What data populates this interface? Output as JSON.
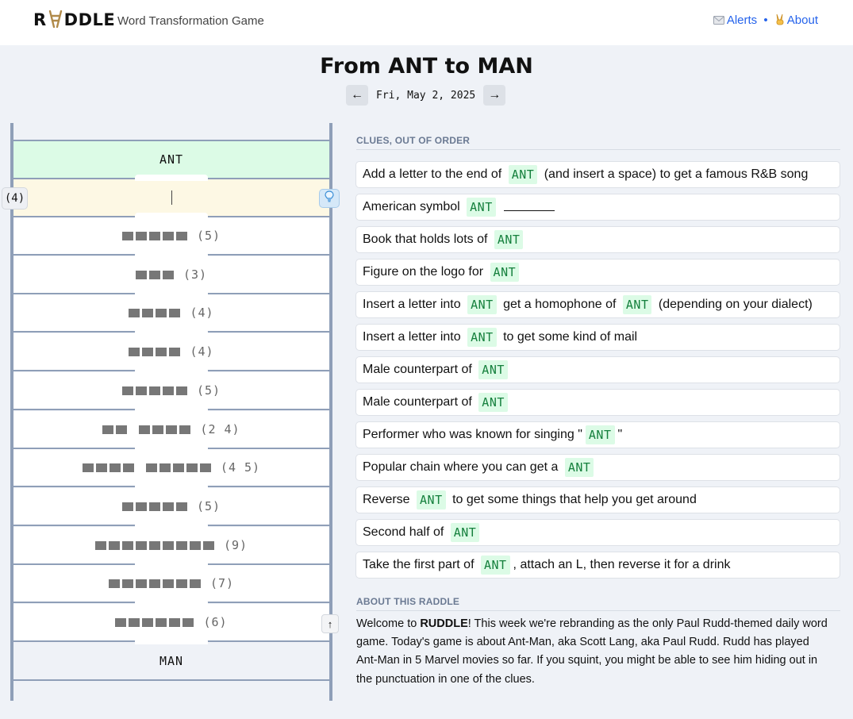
{
  "header": {
    "logo_text": "RVDDLE",
    "subtitle": "Word Transformation Game",
    "alerts_label": "Alerts",
    "about_label": "About",
    "separator": "•"
  },
  "puzzle": {
    "title": "From ANT to MAN",
    "date": "Fri, May 2, 2025",
    "prev_label": "←",
    "next_label": "→"
  },
  "ladder": {
    "start_word": "ANT",
    "end_word": "MAN",
    "active_count_label": "(4)",
    "up_label": "↑",
    "rungs": [
      {
        "words": [
          5
        ],
        "label": "(5)"
      },
      {
        "words": [
          3
        ],
        "label": "(3)"
      },
      {
        "words": [
          4
        ],
        "label": "(4)"
      },
      {
        "words": [
          4
        ],
        "label": "(4)"
      },
      {
        "words": [
          5
        ],
        "label": "(5)"
      },
      {
        "words": [
          2,
          4
        ],
        "label": "(2 4)"
      },
      {
        "words": [
          4,
          5
        ],
        "label": "(4 5)"
      },
      {
        "words": [
          5
        ],
        "label": "(5)"
      },
      {
        "words": [
          9
        ],
        "label": "(9)"
      },
      {
        "words": [
          7
        ],
        "label": "(7)"
      },
      {
        "words": [
          6
        ],
        "label": "(6)"
      }
    ]
  },
  "clues": {
    "heading": "CLUES, OUT OF ORDER",
    "items": [
      {
        "parts": [
          "Add a letter to the end of ",
          "@ANT",
          " (and insert a space) to get a famous R&B song"
        ]
      },
      {
        "parts": [
          "American symbol ",
          "@ANT",
          " ",
          "_blank"
        ]
      },
      {
        "parts": [
          "Book that holds lots of ",
          "@ANT"
        ]
      },
      {
        "parts": [
          "Figure on the logo for ",
          "@ANT"
        ]
      },
      {
        "parts": [
          "Insert a letter into ",
          "@ANT",
          " get a homophone of ",
          "@ANT",
          " (depending on your dialect)"
        ]
      },
      {
        "parts": [
          "Insert a letter into ",
          "@ANT",
          " to get some kind of mail"
        ]
      },
      {
        "parts": [
          "Male counterpart of ",
          "@ANT"
        ]
      },
      {
        "parts": [
          "Male counterpart of ",
          "@ANT"
        ]
      },
      {
        "parts": [
          "Performer who was known for singing \"",
          "@ANT",
          "\""
        ]
      },
      {
        "parts": [
          "Popular chain where you can get a ",
          "@ANT"
        ]
      },
      {
        "parts": [
          "Reverse ",
          "@ANT",
          " to get some things that help you get around"
        ]
      },
      {
        "parts": [
          "Second half of ",
          "@ANT"
        ]
      },
      {
        "parts": [
          "Take the first part of ",
          "@ANT",
          ", attach an L, then reverse it for a drink"
        ]
      }
    ]
  },
  "about": {
    "heading": "ABOUT THIS RADDLE",
    "lead": "Welcome to ",
    "brand": "RUDDLE",
    "body": "! This week we're rebranding as the only Paul Rudd-themed daily word game. Today's game is about Ant-Man, aka Scott Lang, aka Paul Rudd. Rudd has played Ant-Man in 5 Marvel movies so far. If you squint, you might be able to see him hiding out in the punctuation in one of the clues."
  },
  "colors": {
    "accent_green_bg": "#dcfbe6",
    "accent_green_text": "#15803d",
    "active_row_bg": "#fdf8e4",
    "link_blue": "#2563eb",
    "rail": "#8f9fb8"
  },
  "icons": {
    "alerts": "envelope-icon",
    "about": "victory-hand-icon",
    "hint": "lightbulb-icon"
  }
}
